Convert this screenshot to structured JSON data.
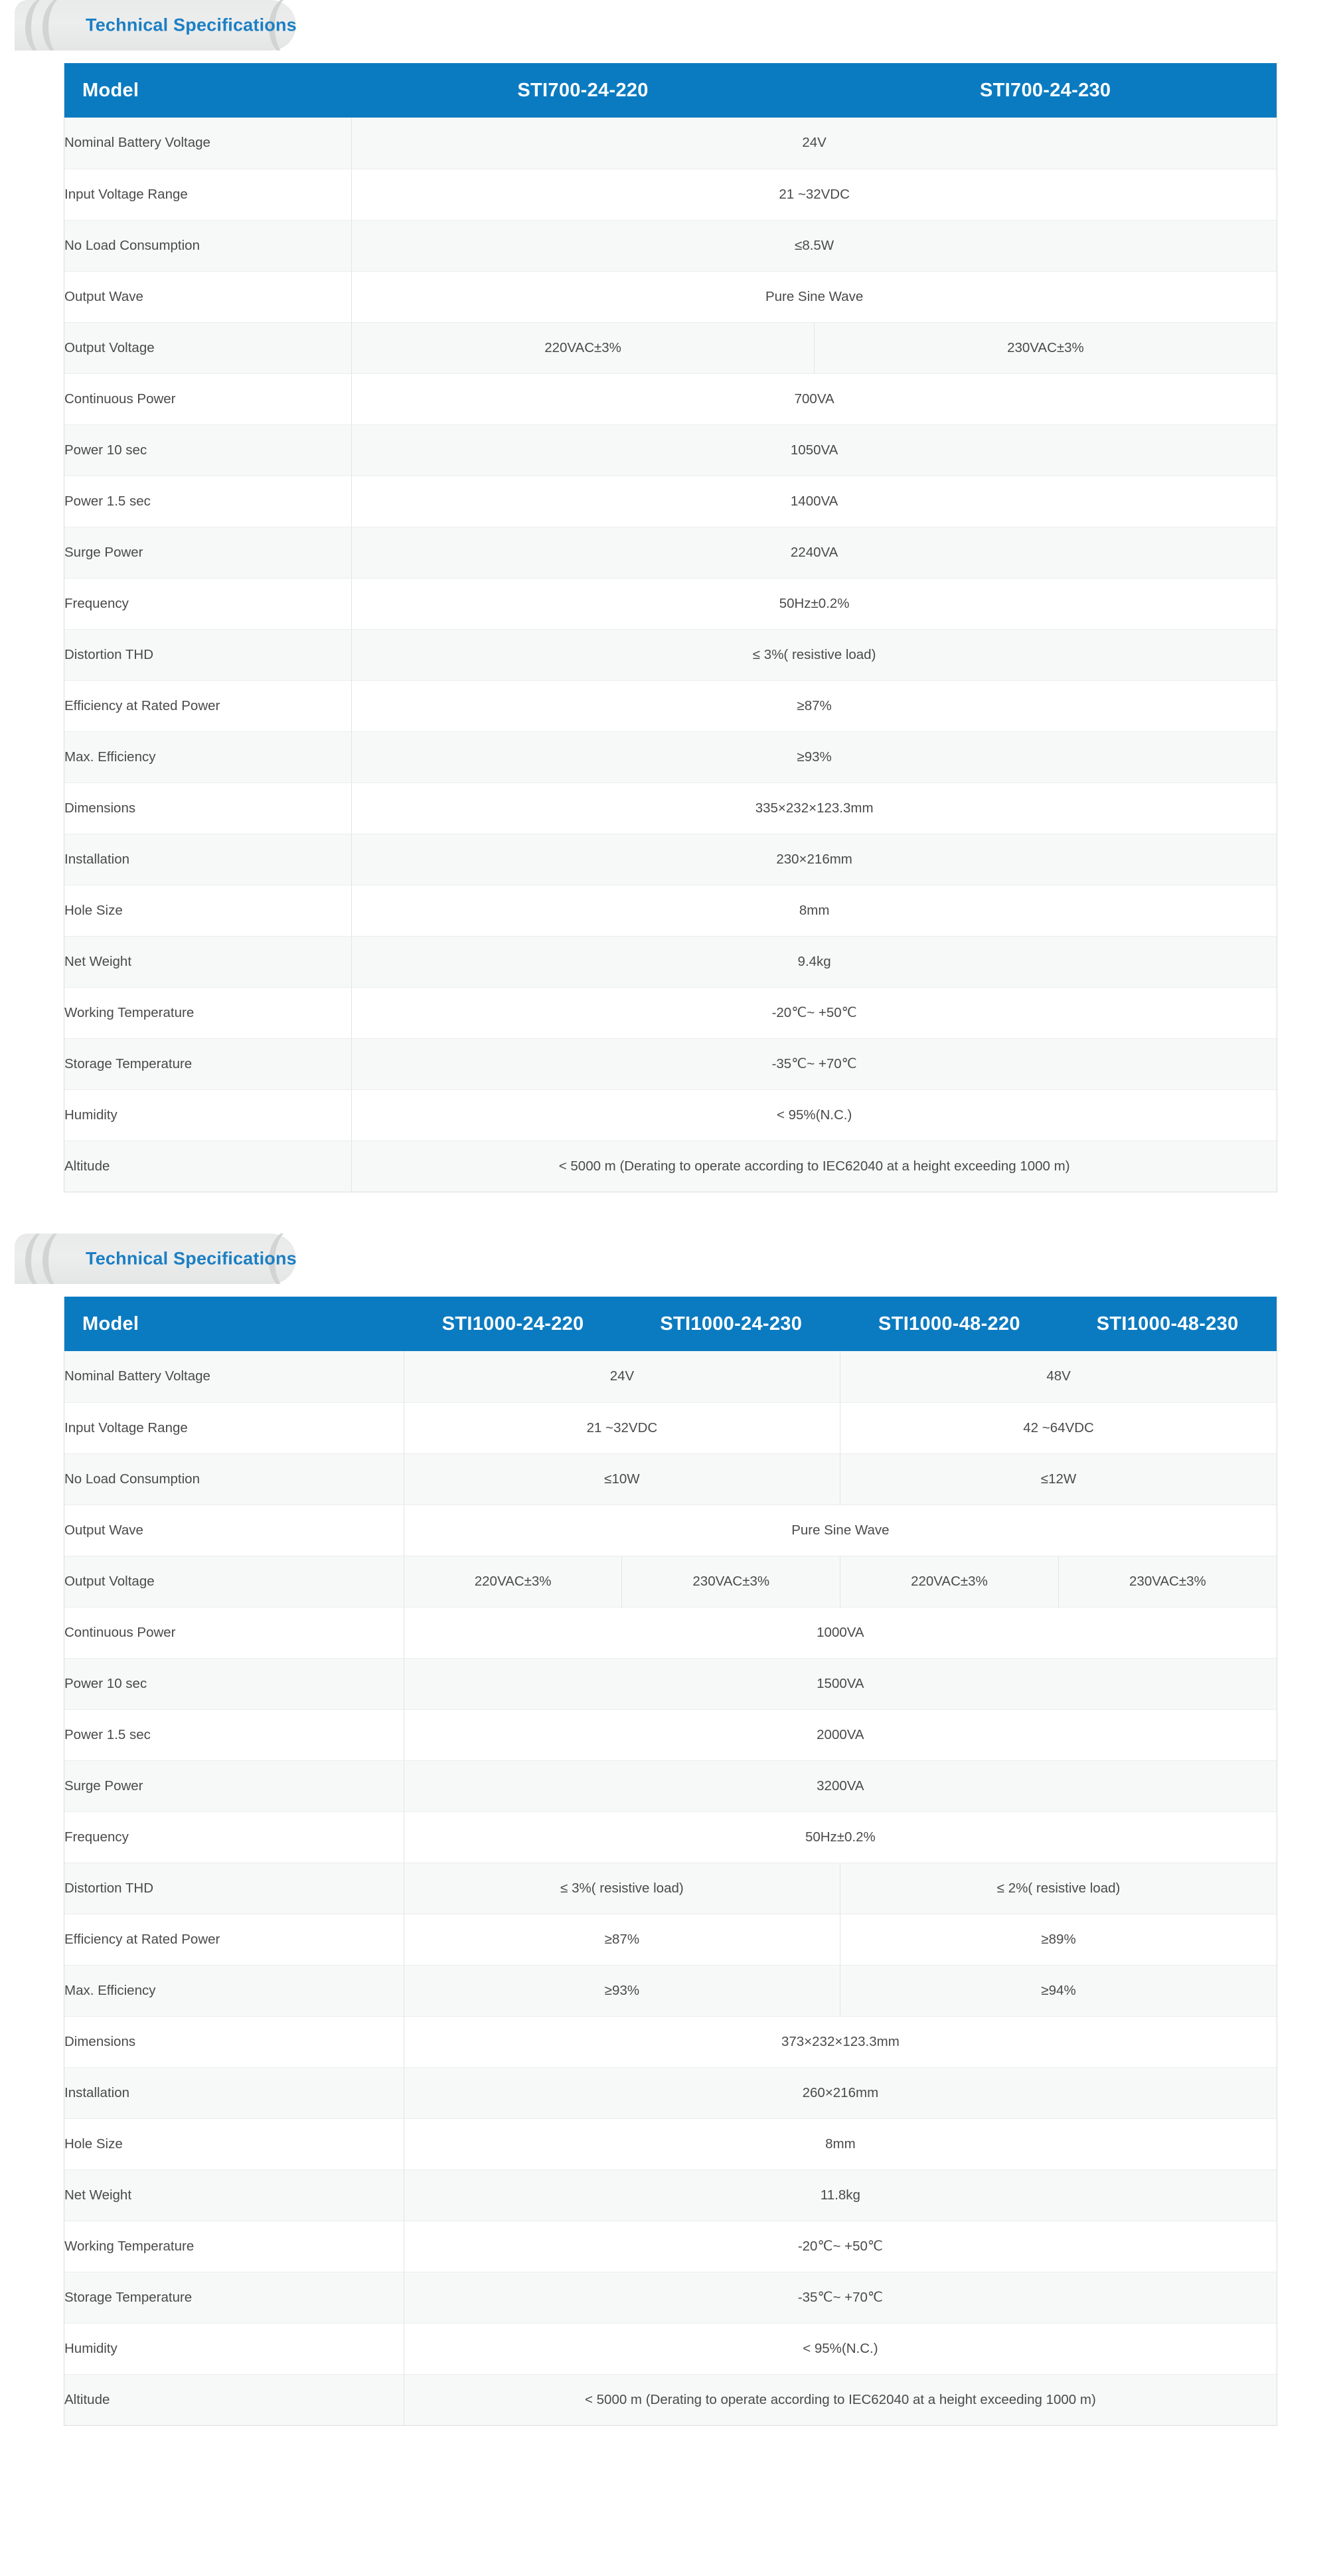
{
  "sections": [
    {
      "tab_title": "Technical Specifications",
      "header": {
        "label": "Model",
        "models": [
          "STI700-24-220",
          "STI700-24-230"
        ]
      },
      "rows": [
        {
          "label": "Nominal Battery Voltage",
          "values": [
            "24V"
          ],
          "spans": [
            2
          ]
        },
        {
          "label": "Input Voltage Range",
          "values": [
            "21 ~32VDC"
          ],
          "spans": [
            2
          ]
        },
        {
          "label": "No Load Consumption",
          "values": [
            "≤8.5W"
          ],
          "spans": [
            2
          ]
        },
        {
          "label": "Output Wave",
          "values": [
            "Pure Sine Wave"
          ],
          "spans": [
            2
          ]
        },
        {
          "label": "Output Voltage",
          "values": [
            "220VAC±3%",
            "230VAC±3%"
          ],
          "spans": [
            1,
            1
          ]
        },
        {
          "label": "Continuous Power",
          "values": [
            "700VA"
          ],
          "spans": [
            2
          ]
        },
        {
          "label": "Power 10 sec",
          "values": [
            "1050VA"
          ],
          "spans": [
            2
          ]
        },
        {
          "label": "Power 1.5 sec",
          "values": [
            "1400VA"
          ],
          "spans": [
            2
          ]
        },
        {
          "label": "Surge Power",
          "values": [
            "2240VA"
          ],
          "spans": [
            2
          ]
        },
        {
          "label": "Frequency",
          "values": [
            "50Hz±0.2%"
          ],
          "spans": [
            2
          ]
        },
        {
          "label": "Distortion THD",
          "values": [
            "≤ 3%( resistive load)"
          ],
          "spans": [
            2
          ]
        },
        {
          "label": "Efficiency at Rated Power",
          "values": [
            "≥87%"
          ],
          "spans": [
            2
          ]
        },
        {
          "label": "Max. Efficiency",
          "values": [
            "≥93%"
          ],
          "spans": [
            2
          ]
        },
        {
          "label": "Dimensions",
          "values": [
            "335×232×123.3mm"
          ],
          "spans": [
            2
          ]
        },
        {
          "label": "Installation",
          "values": [
            "230×216mm"
          ],
          "spans": [
            2
          ]
        },
        {
          "label": "Hole Size",
          "values": [
            "8mm"
          ],
          "spans": [
            2
          ]
        },
        {
          "label": "Net Weight",
          "values": [
            "9.4kg"
          ],
          "spans": [
            2
          ]
        },
        {
          "label": "Working Temperature",
          "values": [
            "-20℃~ +50℃"
          ],
          "spans": [
            2
          ]
        },
        {
          "label": "Storage Temperature",
          "values": [
            "-35℃~ +70℃"
          ],
          "spans": [
            2
          ]
        },
        {
          "label": "Humidity",
          "values": [
            "< 95%(N.C.)"
          ],
          "spans": [
            2
          ]
        },
        {
          "label": "Altitude",
          "values": [
            "< 5000 m (Derating to operate according to IEC62040 at a height exceeding 1000 m)"
          ],
          "spans": [
            2
          ]
        }
      ]
    },
    {
      "tab_title": "Technical Specifications",
      "header": {
        "label": "Model",
        "models": [
          "STI1000-24-220",
          "STI1000-24-230",
          "STI1000-48-220",
          "STI1000-48-230"
        ]
      },
      "rows": [
        {
          "label": "Nominal Battery Voltage",
          "values": [
            "24V",
            "48V"
          ],
          "spans": [
            2,
            2
          ]
        },
        {
          "label": "Input Voltage Range",
          "values": [
            "21 ~32VDC",
            "42 ~64VDC"
          ],
          "spans": [
            2,
            2
          ]
        },
        {
          "label": "No Load Consumption",
          "values": [
            "≤10W",
            "≤12W"
          ],
          "spans": [
            2,
            2
          ]
        },
        {
          "label": "Output Wave",
          "values": [
            "Pure Sine Wave"
          ],
          "spans": [
            4
          ]
        },
        {
          "label": "Output Voltage",
          "values": [
            "220VAC±3%",
            "230VAC±3%",
            "220VAC±3%",
            "230VAC±3%"
          ],
          "spans": [
            1,
            1,
            1,
            1
          ]
        },
        {
          "label": "Continuous Power",
          "values": [
            "1000VA"
          ],
          "spans": [
            4
          ]
        },
        {
          "label": "Power 10 sec",
          "values": [
            "1500VA"
          ],
          "spans": [
            4
          ]
        },
        {
          "label": "Power 1.5 sec",
          "values": [
            "2000VA"
          ],
          "spans": [
            4
          ]
        },
        {
          "label": "Surge Power",
          "values": [
            "3200VA"
          ],
          "spans": [
            4
          ]
        },
        {
          "label": "Frequency",
          "values": [
            "50Hz±0.2%"
          ],
          "spans": [
            4
          ]
        },
        {
          "label": "Distortion THD",
          "values": [
            "≤ 3%( resistive load)",
            "≤ 2%( resistive load)"
          ],
          "spans": [
            2,
            2
          ]
        },
        {
          "label": "Efficiency at Rated Power",
          "values": [
            "≥87%",
            "≥89%"
          ],
          "spans": [
            2,
            2
          ]
        },
        {
          "label": "Max. Efficiency",
          "values": [
            "≥93%",
            "≥94%"
          ],
          "spans": [
            2,
            2
          ]
        },
        {
          "label": "Dimensions",
          "values": [
            "373×232×123.3mm"
          ],
          "spans": [
            4
          ]
        },
        {
          "label": "Installation",
          "values": [
            "260×216mm"
          ],
          "spans": [
            4
          ]
        },
        {
          "label": "Hole Size",
          "values": [
            "8mm"
          ],
          "spans": [
            4
          ]
        },
        {
          "label": "Net Weight",
          "values": [
            "11.8kg"
          ],
          "spans": [
            4
          ]
        },
        {
          "label": "Working Temperature",
          "values": [
            "-20℃~ +50℃"
          ],
          "spans": [
            4
          ]
        },
        {
          "label": "Storage Temperature",
          "values": [
            "-35℃~ +70℃"
          ],
          "spans": [
            4
          ]
        },
        {
          "label": "Humidity",
          "values": [
            "< 95%(N.C.)"
          ],
          "spans": [
            4
          ]
        },
        {
          "label": "Altitude",
          "values": [
            "< 5000 m (Derating to operate according to IEC62040 at a height exceeding 1000 m)"
          ],
          "spans": [
            4
          ]
        }
      ]
    }
  ],
  "colors": {
    "header_blue": "#0b7bc1",
    "tab_title_blue": "#1b7fc4",
    "row_alt": "#f7f8f8",
    "text": "#4a4a4a"
  }
}
